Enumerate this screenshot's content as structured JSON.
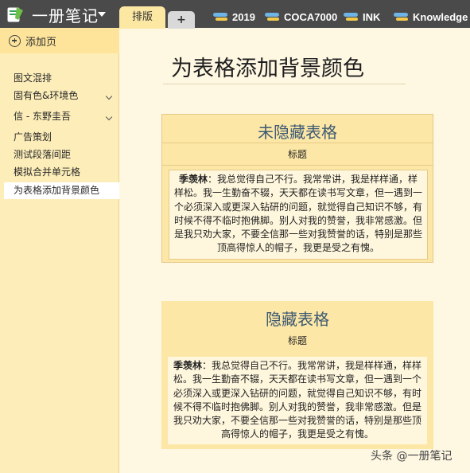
{
  "app": {
    "notebook_title": "一册笔记"
  },
  "tabs": {
    "active": "排版",
    "add_label": "+"
  },
  "sections": [
    "2019",
    "COCA7000",
    "INK",
    "Knowledge"
  ],
  "sidebar": {
    "add_page_label": "添加页",
    "items": [
      {
        "label": "图文混排",
        "expandable": false
      },
      {
        "label": "固有色&环境色",
        "expandable": true
      },
      {
        "label": "信 - 东野圭吾",
        "expandable": true
      },
      {
        "label": "广告策划",
        "expandable": false
      },
      {
        "label": "测试段落间距",
        "expandable": false
      },
      {
        "label": "模拟合并单元格",
        "expandable": false
      },
      {
        "label": "为表格添加背景颜色",
        "expandable": false,
        "selected": true
      }
    ]
  },
  "page": {
    "title": "为表格添加背景颜色",
    "table_visible": {
      "heading": "未隐藏表格",
      "subheading": "标题",
      "author": "季羡林",
      "body": "：我总觉得自己不行。我常常讲，我是样样通，样样松。我一生勤奋不辍，天天都在读书写文章，但一遇到一个必须深入或更深入钻研的问题，就觉得自己知识不够，有时候不得不临时抱佛脚。别人对我的赞誉，我非常感激。但是我只劝大家，不要全信那一些对我赞誉的话，特别是那些顶高得惊人的帽子，我更是受之有愧。"
    },
    "table_hidden": {
      "heading": "隐藏表格",
      "subheading": "标题",
      "author": "季羡林",
      "body": "：我总觉得自己不行。我常常讲，我是样样通，样样松。我一生勤奋不辍，天天都在读书写文章，但一遇到一个必须深入或更深入钻研的问题，就觉得自己知识不够，有时候不得不临时抱佛脚。别人对我的赞誉，我非常感激。但是我只劝大家，不要全信那一些对我赞誉的话，特别是那些顶高得惊人的帽子，我更是受之有愧。"
    }
  },
  "watermark": "头条 @一册笔记",
  "colors": {
    "topbar": "#4a4a4a",
    "active_tab": "#fde8a3",
    "sidebar": "#fdeeb9",
    "page_bg": "#fef7e2",
    "table_fill": "#fde7a6",
    "heading_text": "#3d5a73"
  }
}
